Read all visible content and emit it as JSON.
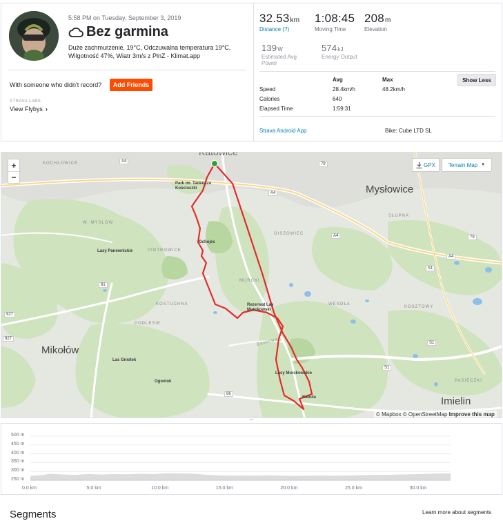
{
  "activity": {
    "date": "5:58 PM on Tuesday, September 3, 2019",
    "title": "Bez garmina",
    "weather_icon": "cloud-icon",
    "description": "Duże zachmurzenie, 19°C, Odczuwalna temperatura 19°C, Wilgotność 47%, Wiatr 3m/s z PlnZ - Klimat.app"
  },
  "social": {
    "prompt": "With someone who didn't record?",
    "add_friends": "Add Friends",
    "labs_label": "STRAVA LABS",
    "flybys": "View Flybys"
  },
  "stats": {
    "distance": {
      "value": "32.53",
      "unit": "km",
      "label": "Distance (?)"
    },
    "moving_time": {
      "value": "1:08:45",
      "label": "Moving Time"
    },
    "elevation": {
      "value": "208",
      "unit": "m",
      "label": "Elevation"
    },
    "power": {
      "value": "139",
      "unit": "W",
      "label": "Estimated Avg Power"
    },
    "energy": {
      "value": "574",
      "unit": "kJ",
      "label": "Energy Output"
    }
  },
  "details": {
    "headers": [
      "Avg",
      "Max"
    ],
    "rows": [
      {
        "label": "Speed",
        "avg": "28.4km/h",
        "max": "48.2km/h"
      },
      {
        "label": "Calories",
        "avg": "640",
        "max": ""
      },
      {
        "label": "Elapsed Time",
        "avg": "1:59:31",
        "max": ""
      }
    ],
    "show_less": "Show Less",
    "device": "Strava Android App",
    "bike": "Bike: Cube LTD SL"
  },
  "map": {
    "zoom_in": "+",
    "zoom_out": "−",
    "gpx": "GPX",
    "map_type": "Terrain Map",
    "attribution": {
      "mapbox": "© Mapbox",
      "osm": "© OpenStreetMap",
      "improve": "Improve this map"
    },
    "route_color": "#e32b2b",
    "start_color": "#2ca02c",
    "places": {
      "katowice": "Katowice",
      "myslowice": "Mysłowice",
      "mikolow": "Mikołów",
      "imielin": "Imielin",
      "lasy_panewnickie": "Lasy Panewnickie",
      "las_gniotek": "Las Gniotek",
      "ogoniok": "Ogoniok",
      "ochojec": "Ochojec",
      "park": "Park im. Tadeusza Kościuszki",
      "rezerwat": "Rezerwat Las Murckowski",
      "lasy_murckowskie": "Lasy Murckowskie",
      "kabula": "Kabula",
      "kochlowice": "KOCHŁOWICE",
      "wymyslow": "W. MYSLOW",
      "piotrowice": "PIOTROWICE",
      "kostuchna": "KOSTUCHNA",
      "podlesie": "PODLESIE",
      "giszowiec": "GISZOWIEC",
      "wesola": "WESOŁA",
      "kosztowy": "KOSZTOWY",
      "pasieczki": "PASIECZKI",
      "slupna": "SŁUPNA",
      "murcki": "MURCKI",
      "baskowa": "Baskowa"
    },
    "roads": {
      "a4_1": "A4",
      "a4_2": "A4",
      "a4_3": "A4",
      "a4_4": "A4",
      "r79a": "79",
      "r79b": "79",
      "r81": "81",
      "r927a": "927",
      "r927b": "927",
      "s1a": "S1",
      "s1b": "S1",
      "s1c": "S1",
      "r86": "86"
    }
  },
  "elevation_chart": {
    "y_ticks": [
      "500 m",
      "450 m",
      "400 m",
      "350 m",
      "300 m",
      "250 m"
    ],
    "x_ticks": [
      "0.0 km",
      "5.0 km",
      "10.0 km",
      "15.0 km",
      "20.0 km",
      "25.0 km",
      "30.0 km"
    ],
    "fill_color": "#dcdcdc"
  },
  "chart_data": {
    "type": "area",
    "xlabel": "",
    "ylabel": "",
    "ylim": [
      250,
      500
    ],
    "xlim": [
      0,
      32.53
    ],
    "x": [
      0,
      1,
      1.5,
      2.5,
      3.5,
      4.5,
      5.5,
      6.5,
      7.5,
      8.5,
      9.5,
      10.5,
      11.5,
      12.5,
      13.5,
      14.5,
      15.5,
      16.5,
      17.5,
      18.5,
      19.5,
      20.5,
      21.5,
      22.5,
      23.5,
      24.5,
      25.5,
      26.5,
      27.5,
      28.5,
      29.5,
      30.5,
      31.5,
      32.53
    ],
    "y": [
      275,
      280,
      287,
      283,
      281,
      286,
      283,
      285,
      284,
      287,
      285,
      290,
      289,
      288,
      282,
      278,
      276,
      277,
      276,
      278,
      276,
      275,
      276,
      277,
      276,
      277,
      279,
      280,
      281,
      283,
      284,
      286,
      288,
      290
    ]
  }
}
